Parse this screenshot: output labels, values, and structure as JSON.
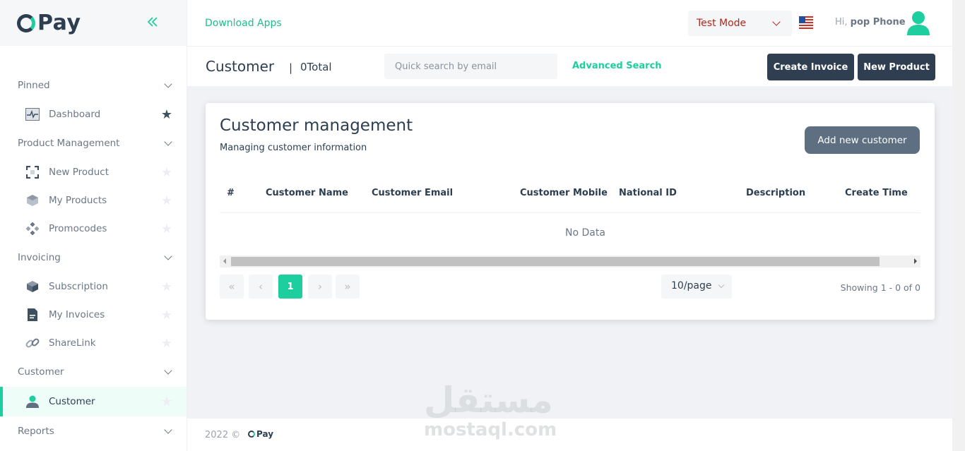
{
  "brand": {
    "logo_text": "Pay",
    "accent": "#1dcf9f",
    "dark": "#2f3e50"
  },
  "header": {
    "download_label": "Download Apps",
    "mode_value": "Test Mode",
    "greeting_prefix": "Hi,",
    "user_name": "pop Phone"
  },
  "sidebar": {
    "groups": [
      {
        "label": "Pinned",
        "items": [
          {
            "label": "Dashboard",
            "icon": "pulse-icon",
            "starred": true
          }
        ]
      },
      {
        "label": "Product Management",
        "items": [
          {
            "label": "New Product",
            "icon": "scan-icon",
            "starred": false
          },
          {
            "label": "My Products",
            "icon": "box-icon",
            "starred": false
          },
          {
            "label": "Promocodes",
            "icon": "diamond-grid-icon",
            "starred": false
          }
        ]
      },
      {
        "label": "Invoicing",
        "items": [
          {
            "label": "Subscription",
            "icon": "cube-icon",
            "starred": false
          },
          {
            "label": "My Invoices",
            "icon": "invoice-icon",
            "starred": false
          },
          {
            "label": "ShareLink",
            "icon": "link-icon",
            "starred": false
          }
        ]
      },
      {
        "label": "Customer",
        "items": [
          {
            "label": "Customer",
            "icon": "user-icon",
            "starred": false,
            "active": true
          }
        ]
      },
      {
        "label": "Reports",
        "items": []
      }
    ]
  },
  "subheader": {
    "title": "Customer",
    "separator": "|",
    "total": "0Total",
    "search_placeholder": "Quick search by email",
    "advanced_label": "Advanced Search",
    "create_invoice_label": "Create Invoice",
    "new_product_label": "New Product"
  },
  "card": {
    "title": "Customer management",
    "subtitle": "Managing customer information",
    "add_button": "Add new customer",
    "columns": [
      "#",
      "Customer Name",
      "Customer Email",
      "Customer Mobile",
      "National ID",
      "Description",
      "Create Time"
    ],
    "empty_text": "No Data",
    "pagination": {
      "first": "«",
      "prev": "‹",
      "current": "1",
      "next": "›",
      "last": "»",
      "page_size": "10/page",
      "showing": "Showing 1 - 0 of 0"
    }
  },
  "footer": {
    "year": "2022 ©",
    "logo_text": "Pay"
  },
  "watermark": {
    "arabic": "مستقل",
    "latin": "mostaql.com"
  }
}
